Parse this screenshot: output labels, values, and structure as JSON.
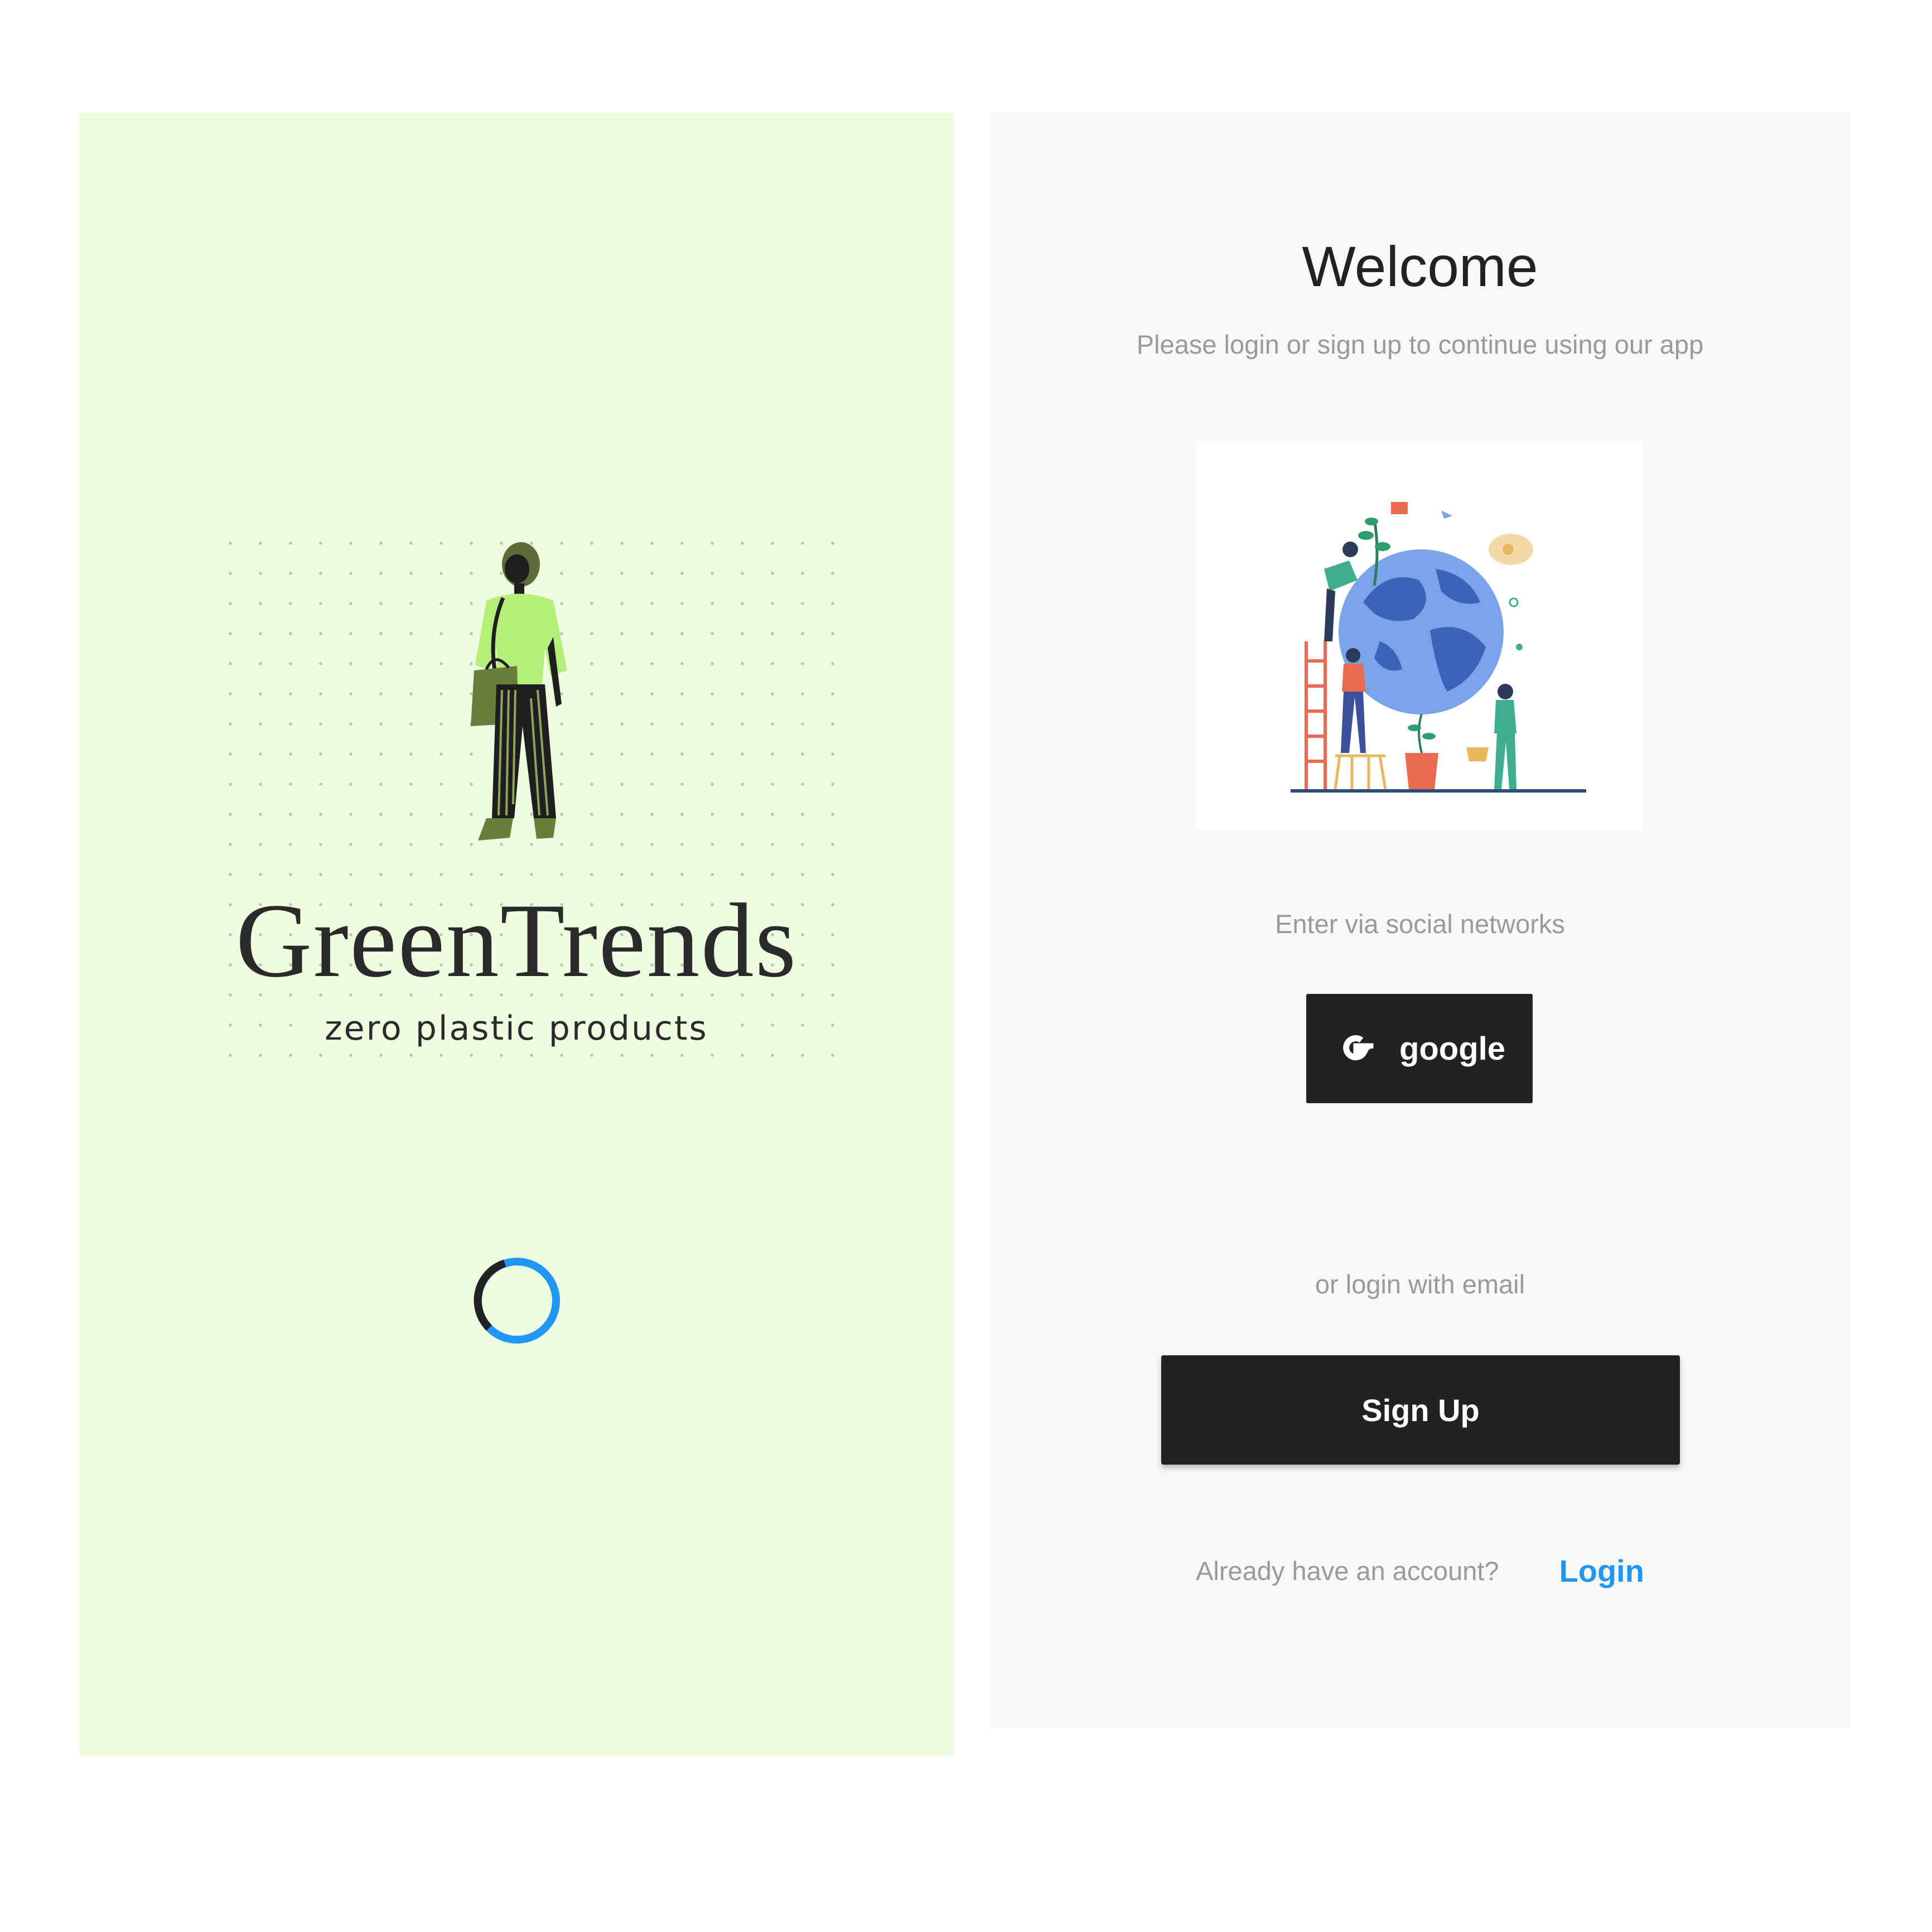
{
  "colors": {
    "splash_bg": "#eefce0",
    "login_bg": "#f8f8f8",
    "button_bg": "#222222",
    "link": "#2196f3",
    "spinner": "#2196f3"
  },
  "splash": {
    "brand_title": "GreenTrends",
    "brand_subtitle": "zero plastic products",
    "illustration_icon": "woman-with-bag",
    "loading_icon": "spinner-icon"
  },
  "login": {
    "title": "Welcome",
    "subtitle": "Please login or sign up to continue using our app",
    "illustration_icon": "globe-people-planting",
    "social_label": "Enter via social networks",
    "google_label": "google",
    "email_label": "or login with email",
    "signup_label": "Sign Up",
    "account_text": "Already have an account?",
    "login_label": "Login"
  }
}
